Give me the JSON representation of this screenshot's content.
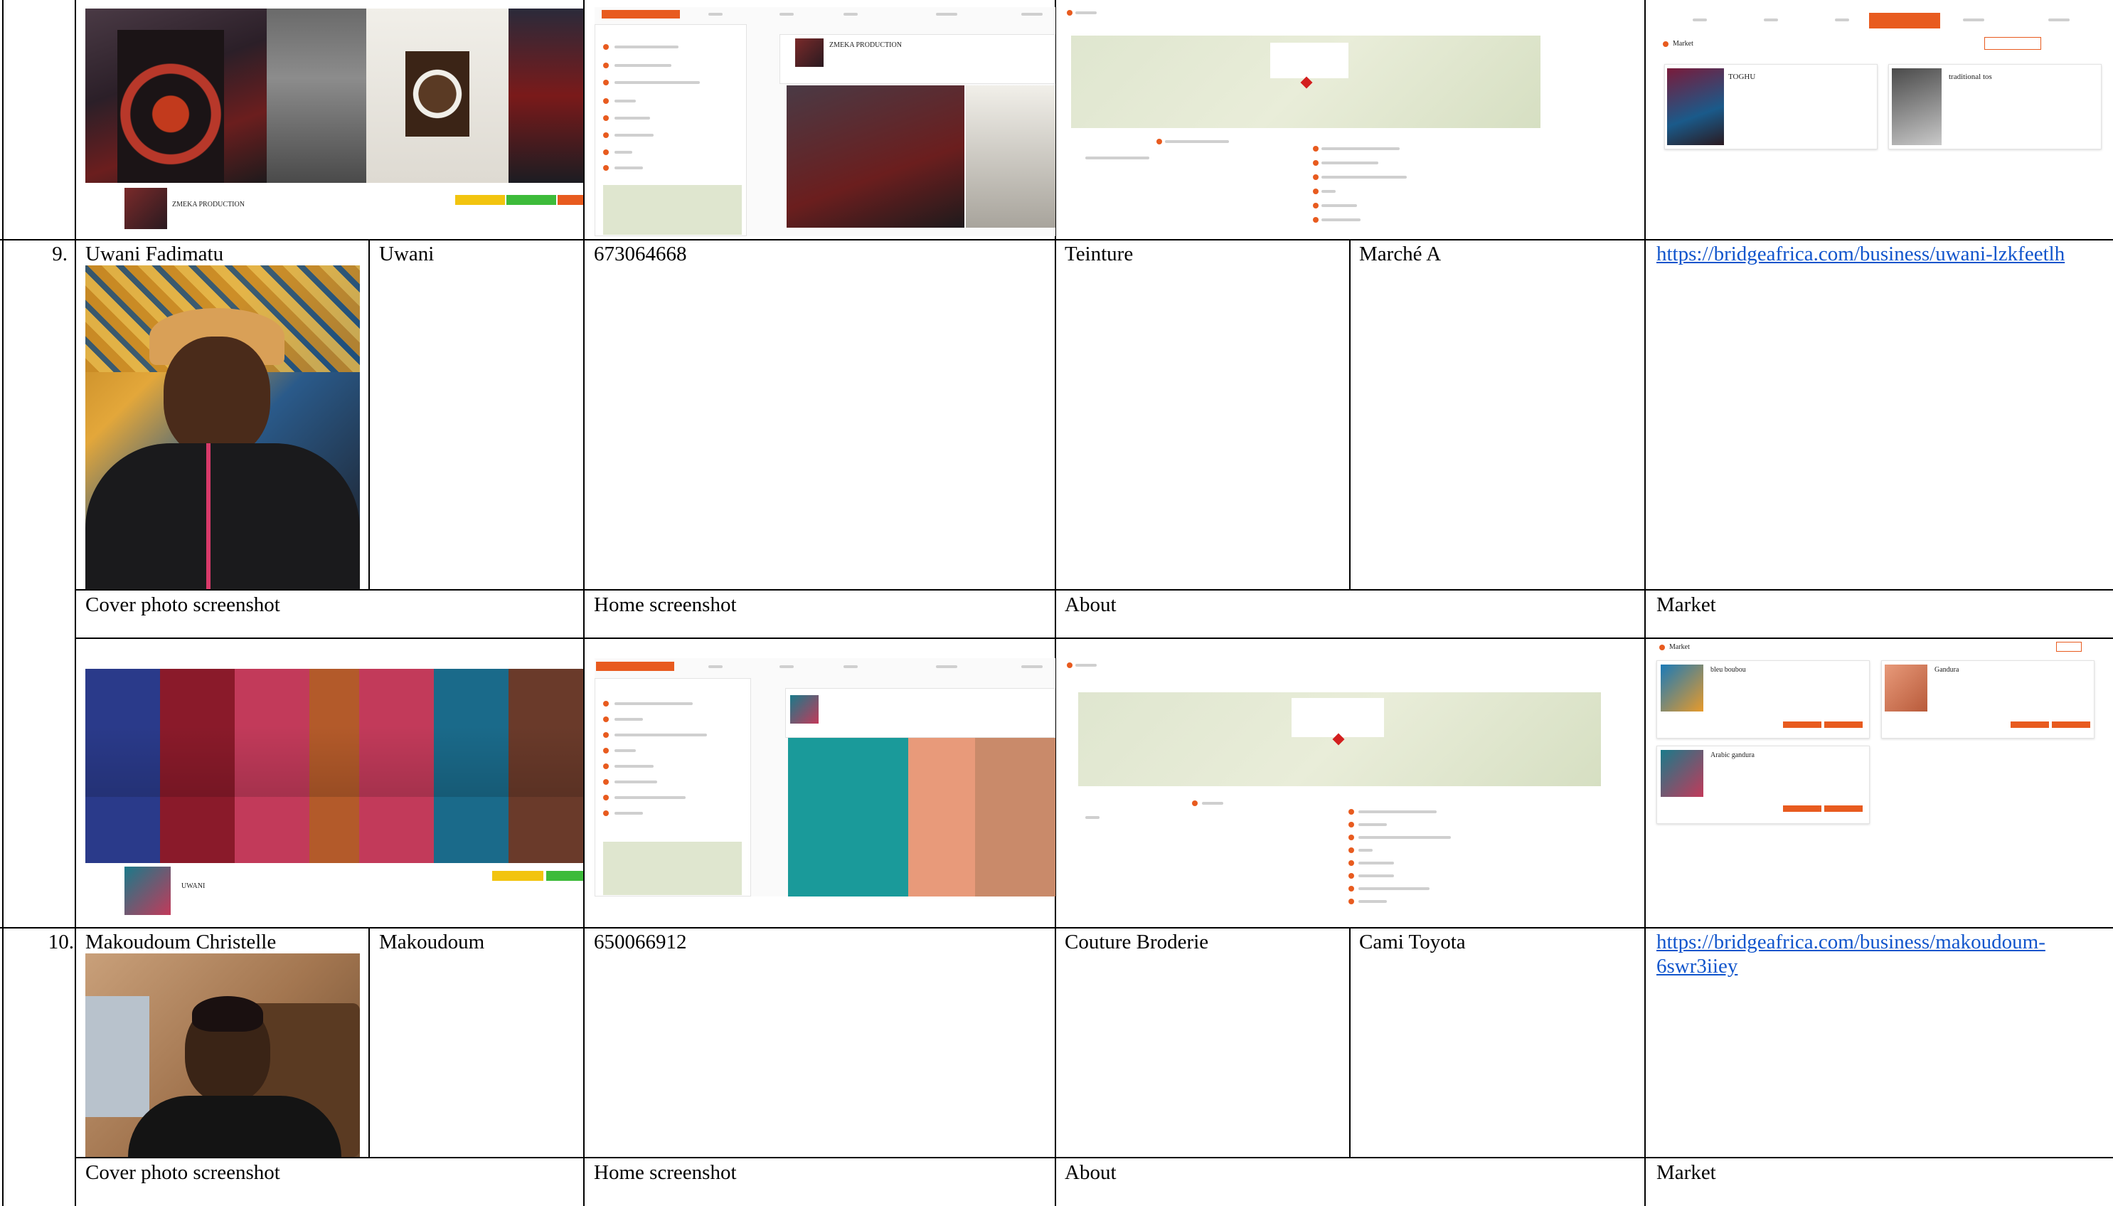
{
  "rows": [
    {
      "number": "9.",
      "full_name": "Uwani Fadimatu",
      "short_name": "Uwani",
      "phone": "673064668",
      "activity": "Teinture",
      "location": "Marché A",
      "link": "https://bridgeafrica.com/business/uwani-lzkfeetlh",
      "labels": {
        "cover": "Cover photo screenshot",
        "home": "Home screenshot",
        "about": "About",
        "market": "Market"
      }
    },
    {
      "number": "10.",
      "full_name": "Makoudoum Christelle",
      "short_name": "Makoudoum",
      "phone": "650066912",
      "activity": "Couture Broderie",
      "location": "Cami Toyota",
      "link_line1": "https://bridgeafrica.com/business/makoudoum-",
      "link_line2": "6swr3iiey",
      "labels": {
        "cover": "Cover photo screenshot",
        "home": "Home screenshot",
        "about": "About",
        "market": "Market"
      }
    }
  ],
  "thumbnails": {
    "top_cover_business": "ZMEKA PRODUCTION",
    "top_home_business": "ZMEKA PRODUCTION",
    "top_market_title": "Market",
    "top_market_items": [
      "TOGHU",
      "traditional tos"
    ],
    "mid_cover_business": "UWANI",
    "mid_market_title": "Market",
    "mid_market_items": [
      "bleu boubou",
      "Gandura",
      "Arabic gandura"
    ]
  },
  "colors": {
    "accent": "#e85b1f",
    "link": "#1155cc",
    "yellow_button": "#f2c40f",
    "green_button": "#3dbb3a"
  }
}
